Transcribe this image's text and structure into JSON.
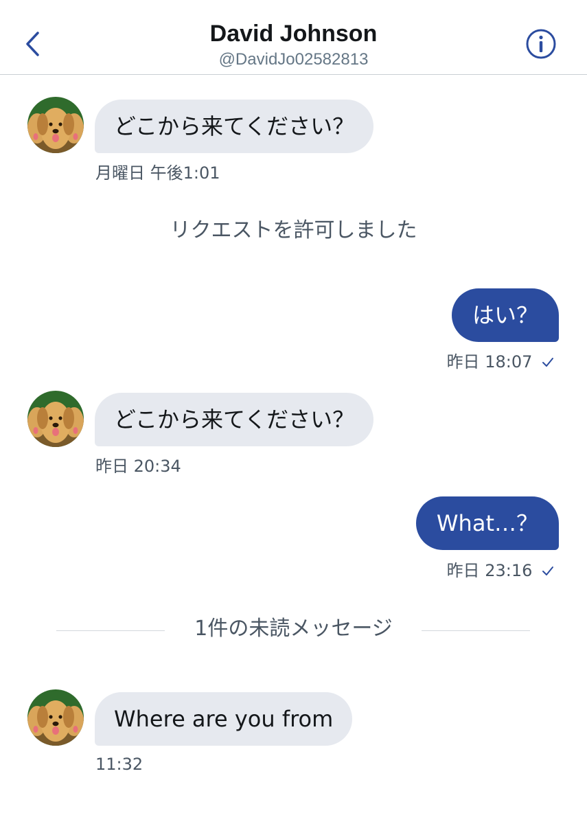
{
  "header": {
    "title": "David Johnson",
    "handle": "@DavidJo02582813",
    "back_icon": "chevron-left-icon",
    "info_icon": "info-circle-icon"
  },
  "colors": {
    "accent": "#2b4c9f",
    "incoming_bubble": "#e6e9ef",
    "timestamp": "#4a5663"
  },
  "messages": [
    {
      "direction": "incoming",
      "text": "どこから来てください？",
      "time": "月曜日 午後1:01"
    },
    {
      "direction": "system",
      "text": "リクエストを許可しました"
    },
    {
      "direction": "outgoing",
      "text": "はい？",
      "time": "昨日 18:07",
      "status_icon": "checkmark-icon"
    },
    {
      "direction": "incoming",
      "text": "どこから来てください？",
      "time": "昨日 20:34"
    },
    {
      "direction": "outgoing",
      "text": "What…？",
      "time": "昨日 23:16",
      "status_icon": "checkmark-icon"
    },
    {
      "direction": "divider",
      "text": "1件の未読メッセージ"
    },
    {
      "direction": "incoming",
      "text": "Where are you from",
      "time": "11:32"
    }
  ]
}
